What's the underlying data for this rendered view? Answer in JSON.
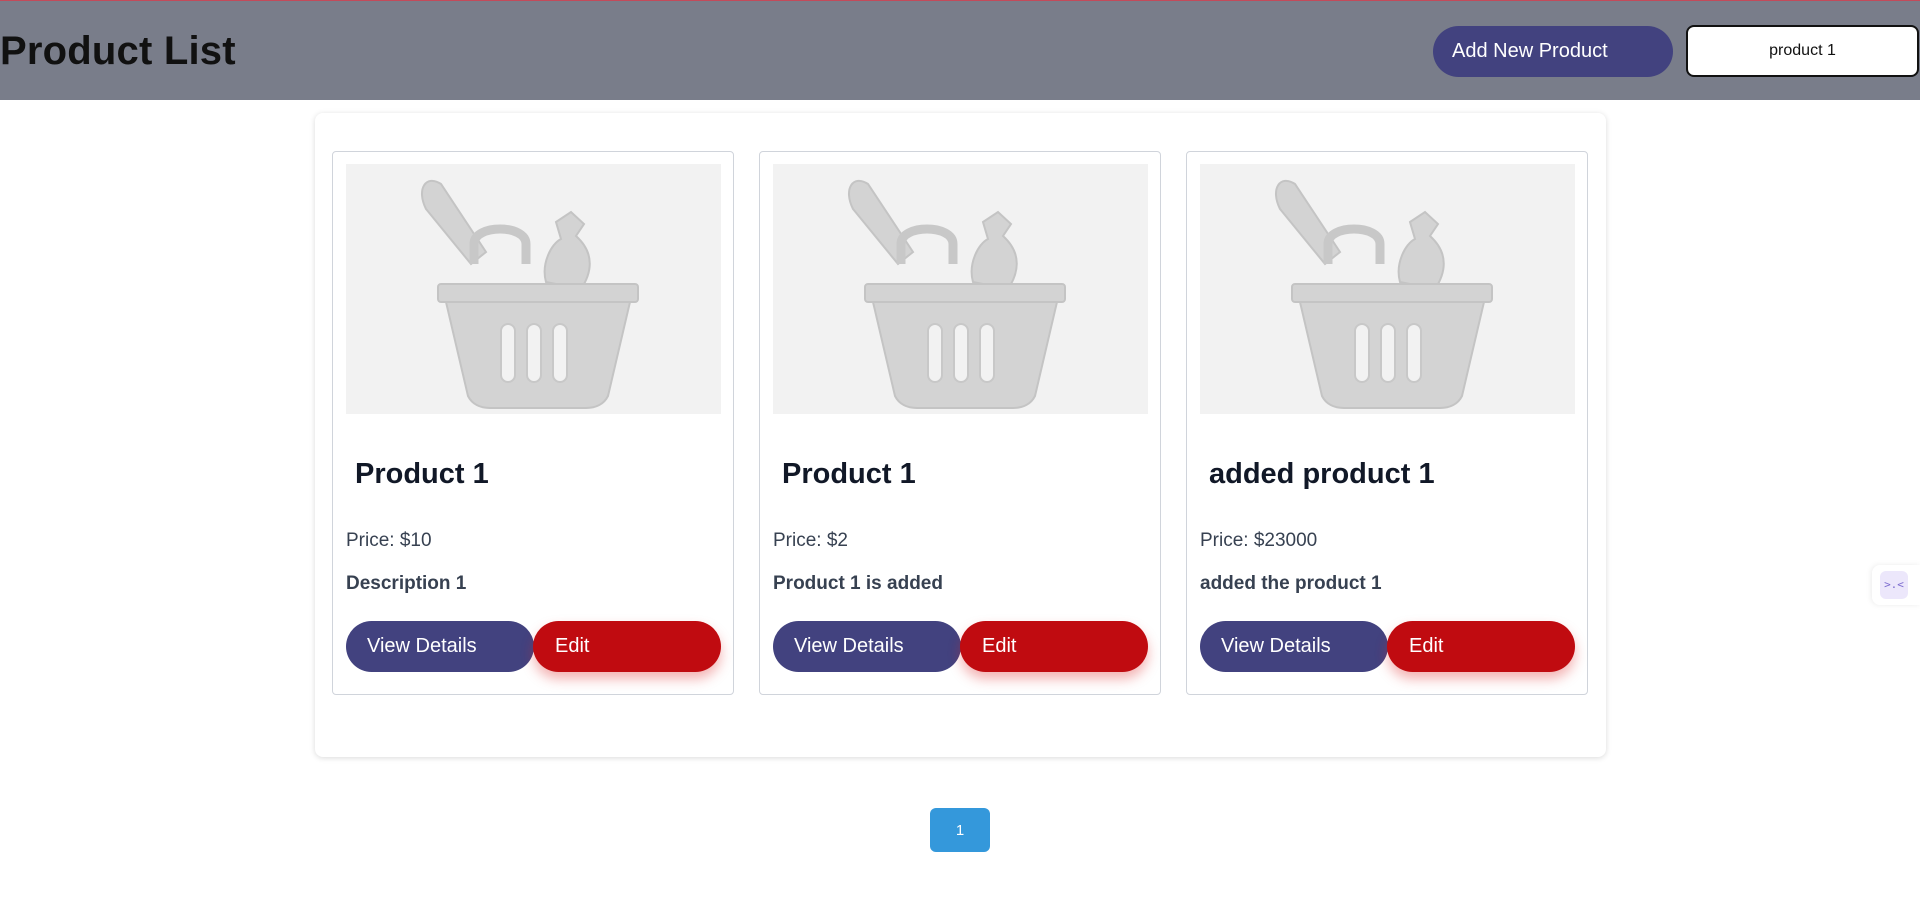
{
  "header": {
    "title": "Product List",
    "add_button_label": "Add New Product",
    "search_value": "product 1"
  },
  "products": [
    {
      "name": "Product 1",
      "price": "Price: $10",
      "description": "Description 1",
      "view_label": "View Details",
      "edit_label": "Edit",
      "image_icon": "basket-placeholder-icon"
    },
    {
      "name": "Product 1",
      "price": "Price: $2",
      "description": "Product 1 is added",
      "view_label": "View Details",
      "edit_label": "Edit",
      "image_icon": "basket-placeholder-icon"
    },
    {
      "name": "added product 1",
      "price": "Price: $23000",
      "description": "added the product 1",
      "view_label": "View Details",
      "edit_label": "Edit",
      "image_icon": "basket-placeholder-icon"
    }
  ],
  "pagination": {
    "pages": [
      "1"
    ],
    "current": "1"
  },
  "widget": {
    "icon": "assistant-face-icon",
    "glyph": ">.<"
  },
  "colors": {
    "header_bg": "#797d8a",
    "primary": "#42427f",
    "danger": "#c00b10",
    "pagination_active": "#3498db"
  }
}
